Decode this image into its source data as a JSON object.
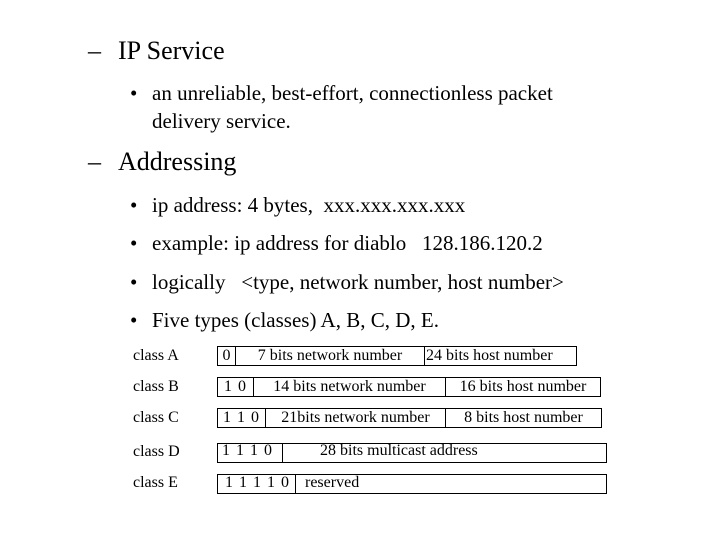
{
  "sections": [
    {
      "marker": "–",
      "title": "IP Service",
      "bullets": [
        {
          "marker": "•",
          "lines": [
            "an unreliable, best-effort, connectionless packet",
            "delivery service."
          ]
        }
      ]
    },
    {
      "marker": "–",
      "title": "Addressing",
      "bullets": [
        {
          "marker": "•",
          "text": "ip address: 4 bytes,  xxx.xxx.xxx.xxx"
        },
        {
          "marker": "•",
          "text": "example: ip address for diablo   128.186.120.2"
        },
        {
          "marker": "•",
          "text": "logically   <type, network number, host number>"
        },
        {
          "marker": "•",
          "text": "Five types (classes) A, B, C, D, E."
        }
      ]
    }
  ],
  "address_classes": [
    {
      "label": "class A",
      "fields": [
        "0",
        "7 bits network number",
        "24 bits host number"
      ]
    },
    {
      "label": "class B",
      "fields": [
        "1 0",
        "14 bits network number",
        "16 bits host number"
      ]
    },
    {
      "label": "class C",
      "fields": [
        "1 1 0",
        "21bits network number",
        "8 bits host number"
      ]
    },
    {
      "label": "class D",
      "fields": [
        "1 1 1 0",
        "28 bits multicast address"
      ]
    },
    {
      "label": "class E",
      "fields": [
        "1 1 1 1 0",
        "reserved"
      ]
    }
  ]
}
